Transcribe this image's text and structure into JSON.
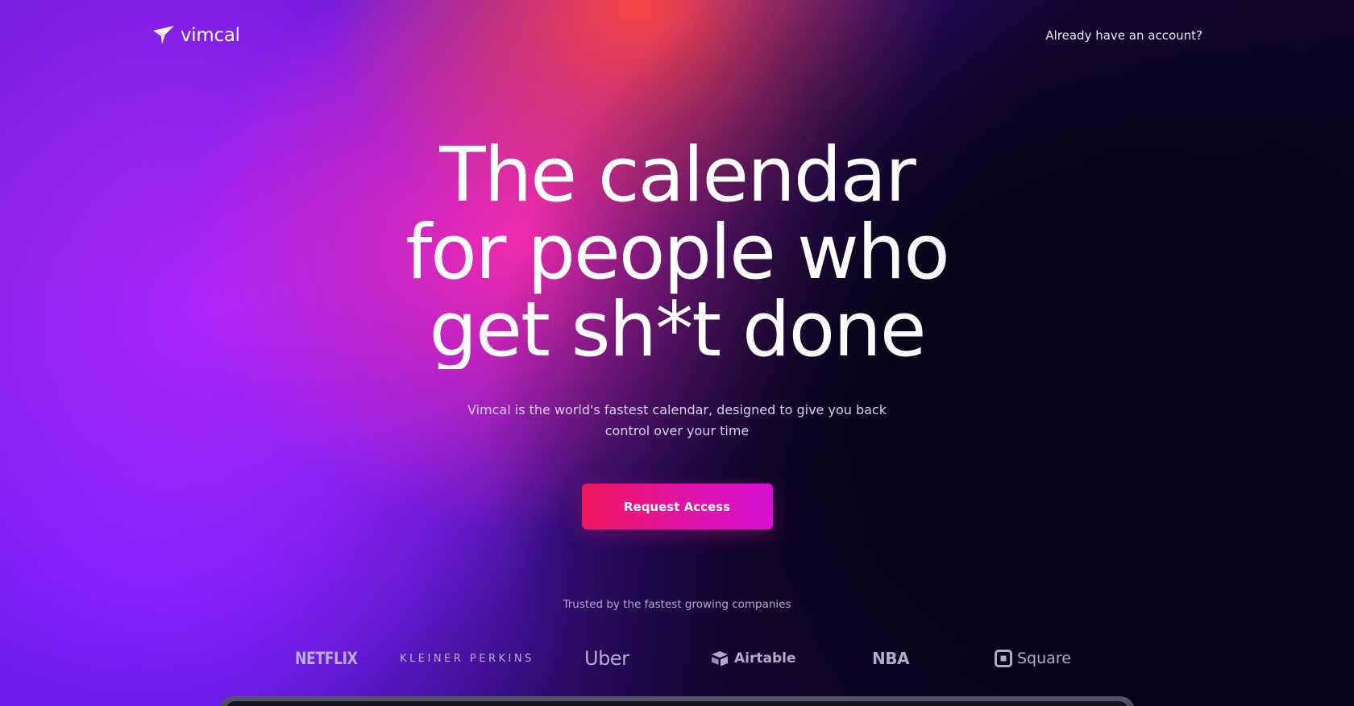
{
  "header": {
    "logo_text": "vimcal",
    "account_link": "Already have an account?"
  },
  "hero": {
    "headline_lines": [
      "The calendar",
      "for people who",
      "get sh*t done"
    ],
    "subtitle": "Vimcal is the world's fastest calendar, designed to give you back control over your time",
    "cta_label": "Request Access"
  },
  "trusted": {
    "label": "Trusted by the fastest growing companies",
    "logos": [
      {
        "name": "NETFLIX",
        "icon": "netflix-logo"
      },
      {
        "name": "KLEINER PERKINS",
        "icon": "kleiner-perkins-logo"
      },
      {
        "name": "Uber",
        "icon": "uber-logo"
      },
      {
        "name": "Airtable",
        "icon": "airtable-logo"
      },
      {
        "name": "NBA",
        "icon": "nba-logo"
      },
      {
        "name": "Square",
        "icon": "square-logo"
      }
    ]
  },
  "colors": {
    "cta_start": "#f0185e",
    "cta_end": "#d611d2",
    "background": "#07031a",
    "glow_purple": "#b028ff",
    "glow_pink": "#ff2daa",
    "glow_red": "#ff463c"
  }
}
